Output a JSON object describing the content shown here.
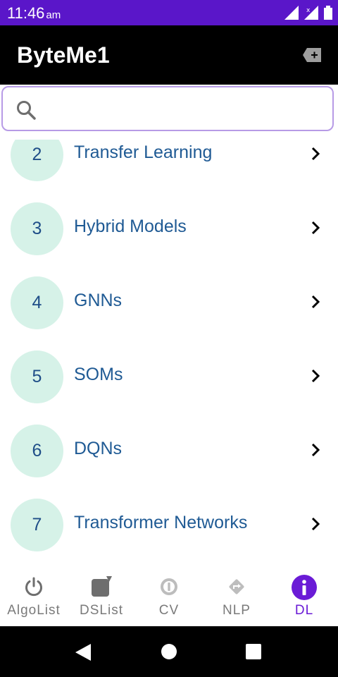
{
  "status_bar": {
    "time": "11:46",
    "ampm": "am"
  },
  "app_bar": {
    "title": "ByteMe1",
    "action_icon": "backspace-plus-icon"
  },
  "search": {
    "placeholder": "",
    "value": "",
    "icon": "search-icon"
  },
  "colors": {
    "accent": "#5a16c9",
    "circle_bg": "#d6f2e8",
    "item_text": "#1f5a94",
    "active_nav": "#6a1bd6"
  },
  "list": {
    "items": [
      {
        "number": "2",
        "label": "Transfer Learning"
      },
      {
        "number": "3",
        "label": "Hybrid Models"
      },
      {
        "number": "4",
        "label": "GNNs"
      },
      {
        "number": "5",
        "label": "SOMs"
      },
      {
        "number": "6",
        "label": "DQNs"
      },
      {
        "number": "7",
        "label": "Transformer Networks"
      }
    ]
  },
  "bottom_nav": {
    "items": [
      {
        "label": "AlgoList",
        "icon": "power-icon"
      },
      {
        "label": "DSList",
        "icon": "note-icon"
      },
      {
        "label": "CV",
        "icon": "info-circle-icon"
      },
      {
        "label": "NLP",
        "icon": "directions-icon"
      },
      {
        "label": "DL",
        "icon": "info-icon",
        "active": true
      }
    ]
  },
  "system_nav": {
    "back": "back-icon",
    "home": "home-icon",
    "recents": "recents-icon"
  }
}
